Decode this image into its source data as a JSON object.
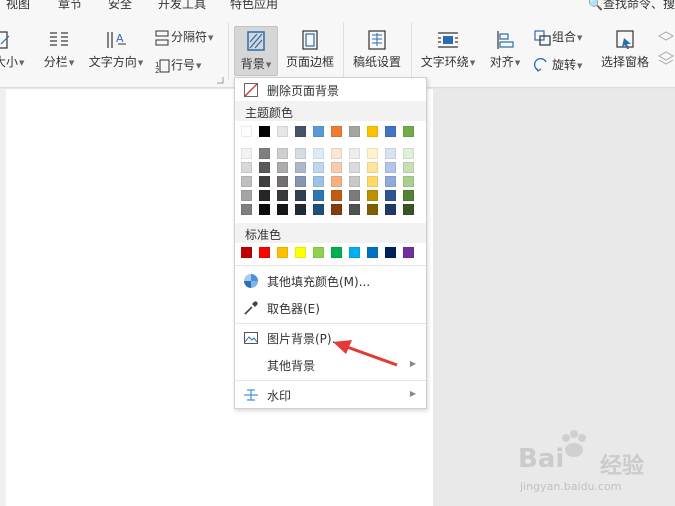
{
  "tabs": [
    "视图",
    "章节",
    "安全",
    "开发工具",
    "特色应用"
  ],
  "search": "查找命令、搜",
  "ribbon": {
    "size_label": "大小",
    "columns_label": "分栏",
    "text_direction_label": "文字方向",
    "separator_label": "分隔符",
    "line_number_label": "行号",
    "background_label": "背景",
    "page_border_label": "页面边框",
    "paper_setup_label": "稿纸设置",
    "text_wrap_label": "文字环绕",
    "align_label": "对齐",
    "group_label": "组合",
    "rotate_label": "旋转",
    "selection_pane_label": "选择窗格"
  },
  "menu": {
    "remove_bg": "删除页面背景",
    "theme_colors": "主题颜色",
    "standard_colors": "标准色",
    "more_fill": "其他填充颜色(M)...",
    "eyedropper": "取色器(E)",
    "picture_bg": "图片背景(P)...",
    "other_bg": "其他背景",
    "watermark": "水印"
  },
  "theme_row": [
    "#ffffff",
    "#000000",
    "#e7e6e6",
    "#44546a",
    "#5b9bd5",
    "#ed7d31",
    "#a5a5a5",
    "#ffc000",
    "#4472c4",
    "#70ad47"
  ],
  "theme_shades": [
    [
      "#f2f2f2",
      "#7f7f7f",
      "#d0cece",
      "#d6dce4",
      "#deebf6",
      "#fbe5d5",
      "#ededed",
      "#fff2cc",
      "#d9e2f3",
      "#e2efd9"
    ],
    [
      "#d8d8d8",
      "#595959",
      "#aeabab",
      "#adb9ca",
      "#bdd7ee",
      "#f7cbac",
      "#dbdbdb",
      "#fee599",
      "#b4c6e7",
      "#c5e0b3"
    ],
    [
      "#bfbfbf",
      "#3f3f3f",
      "#757070",
      "#8496b0",
      "#9cc3e5",
      "#f4b183",
      "#c9c9c9",
      "#ffd965",
      "#8eaadb",
      "#a8d08d"
    ],
    [
      "#a5a5a5",
      "#262626",
      "#3a3838",
      "#323f4f",
      "#2e75b5",
      "#c45911",
      "#7b7b7b",
      "#bf9000",
      "#2f5496",
      "#538135"
    ],
    [
      "#7f7f7f",
      "#0c0c0c",
      "#171616",
      "#222a35",
      "#1e4e79",
      "#833c0b",
      "#525252",
      "#7f6000",
      "#1f3864",
      "#375623"
    ]
  ],
  "standard_row": [
    "#c00000",
    "#ff0000",
    "#ffc000",
    "#ffff00",
    "#92d050",
    "#00b050",
    "#00b0f0",
    "#0070c0",
    "#002060",
    "#7030a0"
  ],
  "watermark_brand": "Bai",
  "watermark_brand2": "经验",
  "watermark_url": "jingyan.baidu.com"
}
